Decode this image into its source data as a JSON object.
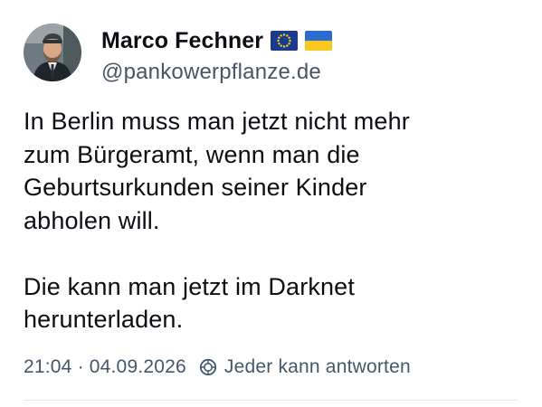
{
  "author": {
    "display_name": "Marco Fechner",
    "handle": "@pankowerpflanze.de",
    "flags": [
      "eu-flag-icon",
      "ukraine-flag-icon"
    ]
  },
  "post": {
    "text": "In Berlin muss man jetzt nicht mehr\nzum Bürgeramt, wenn man die\nGeburtsurkunden seiner Kinder\nabholen will.\n\nDie kann man jetzt im Darknet\nherunterladen.",
    "time": "21:04",
    "separator": "·",
    "date": "04.09.2026",
    "reply_setting": "Jeder kann antworten"
  },
  "colors": {
    "text": "#0b0f14",
    "muted": "#42576b",
    "eu_blue": "#1a3a8f",
    "eu_gold": "#ffd500",
    "ua_blue": "#2d6ad1",
    "ua_yellow": "#f7c71c"
  }
}
